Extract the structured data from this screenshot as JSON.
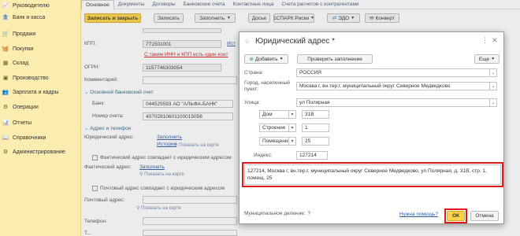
{
  "sidebar": {
    "items": [
      {
        "label": "Руководителю",
        "icon": "chart-line-icon"
      },
      {
        "label": "Банк и касса",
        "icon": "bank-icon"
      },
      {
        "label": "Продажи",
        "icon": "cart-icon"
      },
      {
        "label": "Покупки",
        "icon": "basket-icon"
      },
      {
        "label": "Склад",
        "icon": "warehouse-icon"
      },
      {
        "label": "Производство",
        "icon": "factory-icon"
      },
      {
        "label": "Зарплата и кадры",
        "icon": "people-icon"
      },
      {
        "label": "Операции",
        "icon": "operations-icon"
      },
      {
        "label": "Отчеты",
        "icon": "reports-icon"
      },
      {
        "label": "Справочники",
        "icon": "book-icon"
      },
      {
        "label": "Администрирование",
        "icon": "gear-icon"
      }
    ]
  },
  "form": {
    "tabs": [
      "Основное",
      "Документы",
      "Договоры",
      "Банковские счета",
      "Контактные лица",
      "Счета расчетов с контрагентами"
    ],
    "buttons": {
      "save_close": "Записать и закрыть",
      "save": "Записать",
      "fill": "Заполнить",
      "dossier": "Досье",
      "spark": "1СПАРК Риски",
      "edo": "ЭДО",
      "envelope": "Конверт"
    },
    "fields": {
      "kpp_label": "КПП:",
      "kpp_value": "771501001",
      "kpp_link": "Ист",
      "same_inn_warning": "С таким ИНН и КПП есть один конт",
      "ogrn_label": "ОГРН:",
      "ogrn_value": "1157746303054",
      "comment_label": "Комментарий:",
      "bank_group": "Основной банковский счет",
      "bank_label": "Банк:",
      "bank_value": "044525593 АО \"АЛЬФА-БАНК\"",
      "account_label": "Номер счета:",
      "account_value": "40702810601100015056",
      "address_group": "Адрес и телефон",
      "legal_label": "Юридический адрес:",
      "fill_link": "Заполнить",
      "history_link": "История",
      "show_map": "Показать на карте",
      "fact_same": "Фактический адрес совпадает с юридическим адресом",
      "fact_label": "Фактический адрес:",
      "fact_fill": "Заполнить",
      "fact_map": "Показать на карте",
      "post_same": "Почтовый адрес совпадает с юридическим адресом",
      "post_label": "Почтовый адрес:",
      "post_map": "Показать на карте",
      "phone_label": "Телефон:",
      "partial_label": "Т..."
    }
  },
  "dialog": {
    "title": "Юридический адрес *",
    "add_button": "Добавить",
    "check_button": "Проверить заполнение",
    "more_button": "Еще",
    "country_label": "Страна:",
    "country_value": "РОССИЯ",
    "city_label": "Город, населенный пункт:",
    "city_value": "Москва г, вн.тер.г. муниципальный округ Северное Медведково",
    "street_label": "Улица:",
    "street_value": "ул Полярная",
    "house_type": "Дом",
    "house_value": "31В",
    "building_type": "Строение",
    "building_value": "1",
    "room_type": "Помещение",
    "room_value": "25",
    "index_label": "Индекс:",
    "index_value": "127214",
    "result_text": "127214, Москва г, вн.тер.г. муниципальный округ Северное Медведково, ул Полярная, д. 31В, стр. 1, помещ. 25",
    "municipal_label": "Муниципальное деление:",
    "help_link": "Нужна помощь?",
    "ok_button": "ОК",
    "cancel_button": "Отмена"
  },
  "colors": {
    "sidebar_bg": "#fbedb0",
    "primary_button": "#fbd34a",
    "highlight": "#e0191c"
  }
}
